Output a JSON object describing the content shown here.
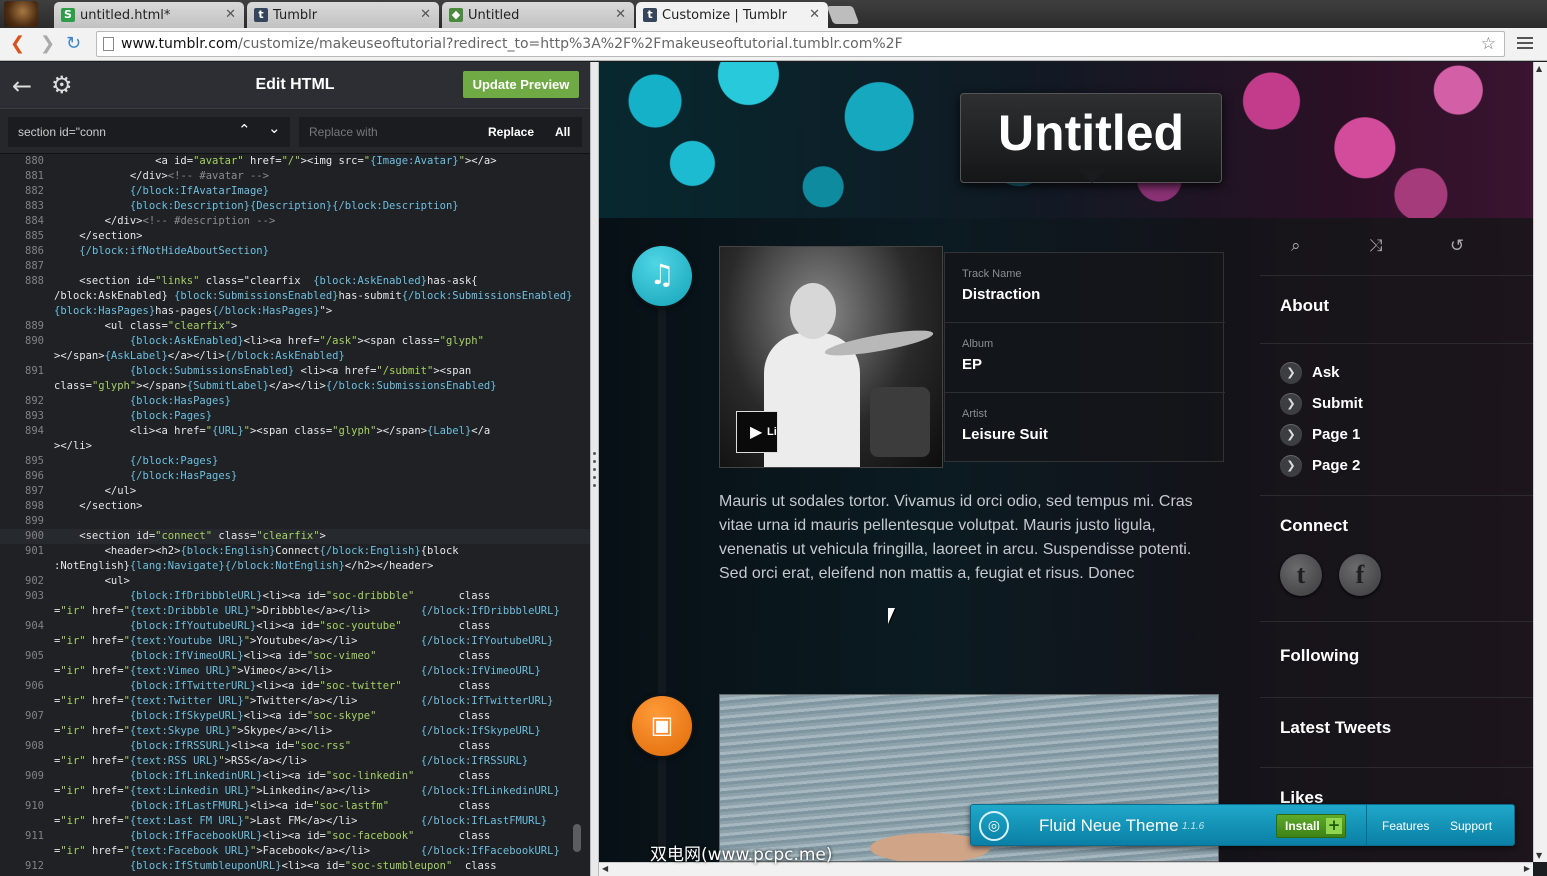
{
  "browser": {
    "tabs": [
      {
        "label": "untitled.html*",
        "icon": "S",
        "icon_color": "#2e9d4a"
      },
      {
        "label": "Tumblr",
        "icon": "t",
        "icon_color": "#35465c"
      },
      {
        "label": "Untitled",
        "icon": "◆",
        "icon_color": "#4a8a3c"
      },
      {
        "label": "Customize | Tumblr",
        "icon": "t",
        "icon_color": "#35465c"
      }
    ],
    "url_host": "www.tumblr.com",
    "url_path": "/customize/makeuseoftutorial?redirect_to=http%3A%2F%2Fmakeuseoftutorial.tumblr.com%2F"
  },
  "editor": {
    "title": "Edit HTML",
    "update_label": "Update Preview",
    "search_value": "section id=\"conn",
    "replace_placeholder": "Replace with",
    "replace_label": "Replace",
    "all_label": "All",
    "code_lines": [
      {
        "n": "880",
        "html": "                <a id=\"avatar\" href=\"/\"><img src=\"{Image:Avatar}\"></a>"
      },
      {
        "n": "881",
        "html": "            </div><!-- #avatar -->"
      },
      {
        "n": "882",
        "html": "            {/block:IfAvatarImage}"
      },
      {
        "n": "883",
        "html": "            {block:Description}{Description}{/block:Description}"
      },
      {
        "n": "884",
        "html": "        </div><!-- #description -->"
      },
      {
        "n": "885",
        "html": "    </section>"
      },
      {
        "n": "886",
        "html": "    {/block:ifNotHideAboutSection}"
      },
      {
        "n": "887",
        "html": ""
      },
      {
        "n": "888",
        "html": "    <section id=\"links\" class=\"clearfix  {block:AskEnabled}has-ask{"
      },
      {
        "n": "",
        "html": "/block:AskEnabled} {block:SubmissionsEnabled}has-submit{/block:SubmissionsEnabled}"
      },
      {
        "n": "",
        "html": "{block:HasPages}has-pages{/block:HasPages}\">"
      },
      {
        "n": "889",
        "html": "        <ul class=\"clearfix\">"
      },
      {
        "n": "890",
        "html": "            {block:AskEnabled}<li><a href=\"/ask\"><span class=\"glyph\""
      },
      {
        "n": "",
        "html": "></span>{AskLabel}</a></li>{/block:AskEnabled}"
      },
      {
        "n": "891",
        "html": "            {block:SubmissionsEnabled} <li><a href=\"/submit\"><span"
      },
      {
        "n": "",
        "html": "class=\"glyph\"></span>{SubmitLabel}</a></li>{/block:SubmissionsEnabled}"
      },
      {
        "n": "892",
        "html": "            {block:HasPages}"
      },
      {
        "n": "893",
        "html": "            {block:Pages}"
      },
      {
        "n": "894",
        "html": "            <li><a href=\"{URL}\"><span class=\"glyph\"></span>{Label}</a"
      },
      {
        "n": "",
        "html": "></li>"
      },
      {
        "n": "895",
        "html": "            {/block:Pages}"
      },
      {
        "n": "896",
        "html": "            {/block:HasPages}"
      },
      {
        "n": "897",
        "html": "        </ul>"
      },
      {
        "n": "898",
        "html": "    </section>"
      },
      {
        "n": "899",
        "html": ""
      },
      {
        "n": "900",
        "html": "    <section id=\"connect\" class=\"clearfix\">"
      },
      {
        "n": "901",
        "html": "        <header><h2>{block:English}Connect{/block:English}{block"
      },
      {
        "n": "",
        "html": ":NotEnglish}{lang:Navigate}{/block:NotEnglish}</h2></header>"
      },
      {
        "n": "902",
        "html": "        <ul>"
      },
      {
        "n": "903",
        "html": "            {block:IfDribbbleURL}<li><a id=\"soc-dribbble\"       class"
      },
      {
        "n": "",
        "html": "=\"ir\" href=\"{text:Dribbble URL}\">Dribbble</a></li>        {/block:IfDribbbleURL}"
      },
      {
        "n": "904",
        "html": "            {block:IfYoutubeURL}<li><a id=\"soc-youtube\"         class"
      },
      {
        "n": "",
        "html": "=\"ir\" href=\"{text:Youtube URL}\">Youtube</a></li>          {/block:IfYoutubeURL}"
      },
      {
        "n": "905",
        "html": "            {block:IfVimeoURL}<li><a id=\"soc-vimeo\"             class"
      },
      {
        "n": "",
        "html": "=\"ir\" href=\"{text:Vimeo URL}\">Vimeo</a></li>              {/block:IfVimeoURL}"
      },
      {
        "n": "906",
        "html": "            {block:IfTwitterURL}<li><a id=\"soc-twitter\"         class"
      },
      {
        "n": "",
        "html": "=\"ir\" href=\"{text:Twitter URL}\">Twitter</a></li>          {/block:IfTwitterURL}"
      },
      {
        "n": "907",
        "html": "            {block:IfSkypeURL}<li><a id=\"soc-skype\"             class"
      },
      {
        "n": "",
        "html": "=\"ir\" href=\"{text:Skype URL}\">Skype</a></li>              {/block:IfSkypeURL}"
      },
      {
        "n": "908",
        "html": "            {block:IfRSSURL}<li><a id=\"soc-rss\"                 class"
      },
      {
        "n": "",
        "html": "=\"ir\" href=\"{text:RSS URL}\">RSS</a></li>                  {/block:IfRSSURL}"
      },
      {
        "n": "909",
        "html": "            {block:IfLinkedinURL}<li><a id=\"soc-linkedin\"       class"
      },
      {
        "n": "",
        "html": "=\"ir\" href=\"{text:Linkedin URL}\">Linkedin</a></li>        {/block:IfLinkedinURL}"
      },
      {
        "n": "910",
        "html": "            {block:IfLastFMURL}<li><a id=\"soc-lastfm\"           class"
      },
      {
        "n": "",
        "html": "=\"ir\" href=\"{text:Last FM URL}\">Last FM</a></li>          {/block:IfLastFMURL}"
      },
      {
        "n": "911",
        "html": "            {block:IfFacebookURL}<li><a id=\"soc-facebook\"       class"
      },
      {
        "n": "",
        "html": "=\"ir\" href=\"{text:Facebook URL}\">Facebook</a></li>        {/block:IfFacebookURL}"
      },
      {
        "n": "912",
        "html": "            {block:IfStumbleuponURL}<li><a id=\"soc-stumbleupon\"  class"
      }
    ]
  },
  "preview": {
    "blog_title": "Untitled",
    "audio_post": {
      "track_label": "Track Name",
      "track_value": "Distraction",
      "album_label": "Album",
      "album_value": "EP",
      "artist_label": "Artist",
      "artist_value": "Leisure Suit",
      "play_label": "Li"
    },
    "body_text": "Mauris ut sodales tortor. Vivamus id orci odio, sed tempus mi. Cras vitae urna id mauris pellentesque volutpat. Mauris justo ligula, venenatis ut vehicula fringilla, laoreet in arcu. Suspendisse potenti. Sed orci erat, eleifend non mattis a, feugiat et risus. Donec",
    "sidebar": {
      "about_title": "About",
      "links": [
        "Ask",
        "Submit",
        "Page 1",
        "Page 2"
      ],
      "connect_title": "Connect",
      "following_title": "Following",
      "latest_tweets_title": "Latest Tweets",
      "likes_title": "Likes"
    },
    "theme_bar": {
      "name": "Fluid Neue Theme",
      "version": "1.1.6",
      "install_label": "Install",
      "features_label": "Features",
      "support_label": "Support"
    }
  },
  "watermark": "双电网(www.pcpc.me)",
  "colors": {
    "update_button": "#6faa44",
    "music_icon": "#1cb6c8",
    "photo_icon": "#f07a12",
    "theme_bar": "#1fa8c9"
  }
}
